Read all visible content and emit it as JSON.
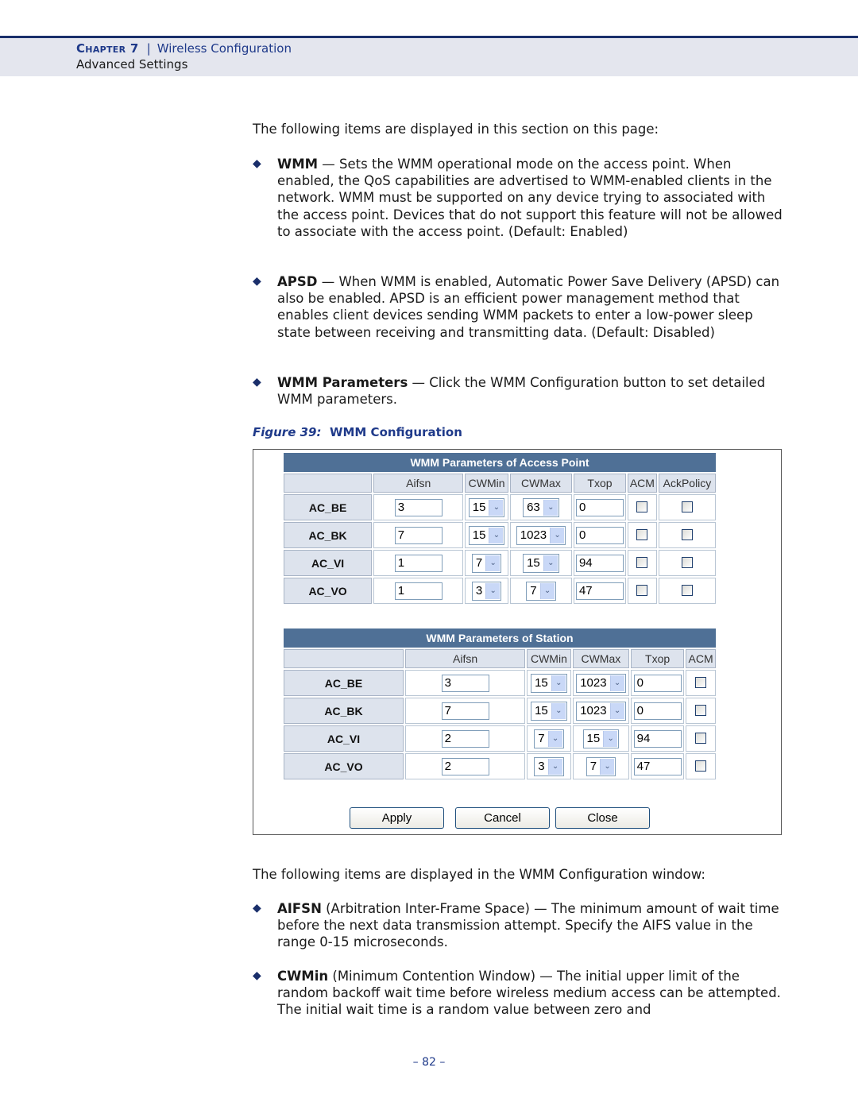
{
  "header": {
    "chapter_label": "Chapter 7",
    "separator": "|",
    "chapter_title": "Wireless Configuration",
    "section": "Advanced Settings"
  },
  "intro": "The following items are displayed in this section on this page:",
  "bullets": [
    {
      "term": "WMM",
      "text": " — Sets the WMM operational mode on the access point. When enabled, the QoS capabilities are advertised to WMM-enabled clients in the network. WMM must be supported on any device trying to associated with the access point. Devices that do not support this feature will not be allowed to associate with the access point. (Default: Enabled)"
    },
    {
      "term": "APSD",
      "text": " — When WMM is enabled, Automatic Power Save Delivery (APSD) can also be enabled. APSD is an efficient power management method that enables client devices sending WMM packets to enter a low-power sleep state between receiving and transmitting data. (Default: Disabled)"
    },
    {
      "term": "WMM Parameters",
      "text": " — Click the WMM Configuration button to set detailed WMM parameters."
    }
  ],
  "figure": {
    "label": "Figure 39:",
    "title": "WMM Configuration"
  },
  "ap_table": {
    "title": "WMM Parameters of Access Point",
    "columns": [
      "",
      "Aifsn",
      "CWMin",
      "CWMax",
      "Txop",
      "ACM",
      "AckPolicy"
    ],
    "rows": [
      {
        "name": "AC_BE",
        "aifsn": "3",
        "cwmin": "15",
        "cwmax": "63",
        "txop": "0",
        "acm": false,
        "ackpolicy": false
      },
      {
        "name": "AC_BK",
        "aifsn": "7",
        "cwmin": "15",
        "cwmax": "1023",
        "txop": "0",
        "acm": false,
        "ackpolicy": false
      },
      {
        "name": "AC_VI",
        "aifsn": "1",
        "cwmin": "7",
        "cwmax": "15",
        "txop": "94",
        "acm": false,
        "ackpolicy": false
      },
      {
        "name": "AC_VO",
        "aifsn": "1",
        "cwmin": "3",
        "cwmax": "7",
        "txop": "47",
        "acm": false,
        "ackpolicy": false
      }
    ]
  },
  "sta_table": {
    "title": "WMM Parameters of Station",
    "columns": [
      "",
      "Aifsn",
      "CWMin",
      "CWMax",
      "Txop",
      "ACM"
    ],
    "rows": [
      {
        "name": "AC_BE",
        "aifsn": "3",
        "cwmin": "15",
        "cwmax": "1023",
        "txop": "0",
        "acm": false
      },
      {
        "name": "AC_BK",
        "aifsn": "7",
        "cwmin": "15",
        "cwmax": "1023",
        "txop": "0",
        "acm": false
      },
      {
        "name": "AC_VI",
        "aifsn": "2",
        "cwmin": "7",
        "cwmax": "15",
        "txop": "94",
        "acm": false
      },
      {
        "name": "AC_VO",
        "aifsn": "2",
        "cwmin": "3",
        "cwmax": "7",
        "txop": "47",
        "acm": false
      }
    ]
  },
  "buttons": {
    "apply": "Apply",
    "cancel": "Cancel",
    "close": "Close"
  },
  "outro": "The following items are displayed in the WMM Configuration window:",
  "bullets2": [
    {
      "term": "AIFSN",
      "text": " (Arbitration Inter-Frame Space) — The minimum amount of wait time before the next data transmission attempt. Specify the AIFS value in the range 0-15 microseconds."
    },
    {
      "term": "CWMin",
      "text": " (Minimum Contention Window) — The initial upper limit of the random backoff wait time before wireless medium access can be attempted. The initial wait time is a random value between zero and"
    }
  ],
  "page_number": "– 82 –",
  "icons": {
    "bullet": "◆",
    "dropdown": "⌄"
  }
}
